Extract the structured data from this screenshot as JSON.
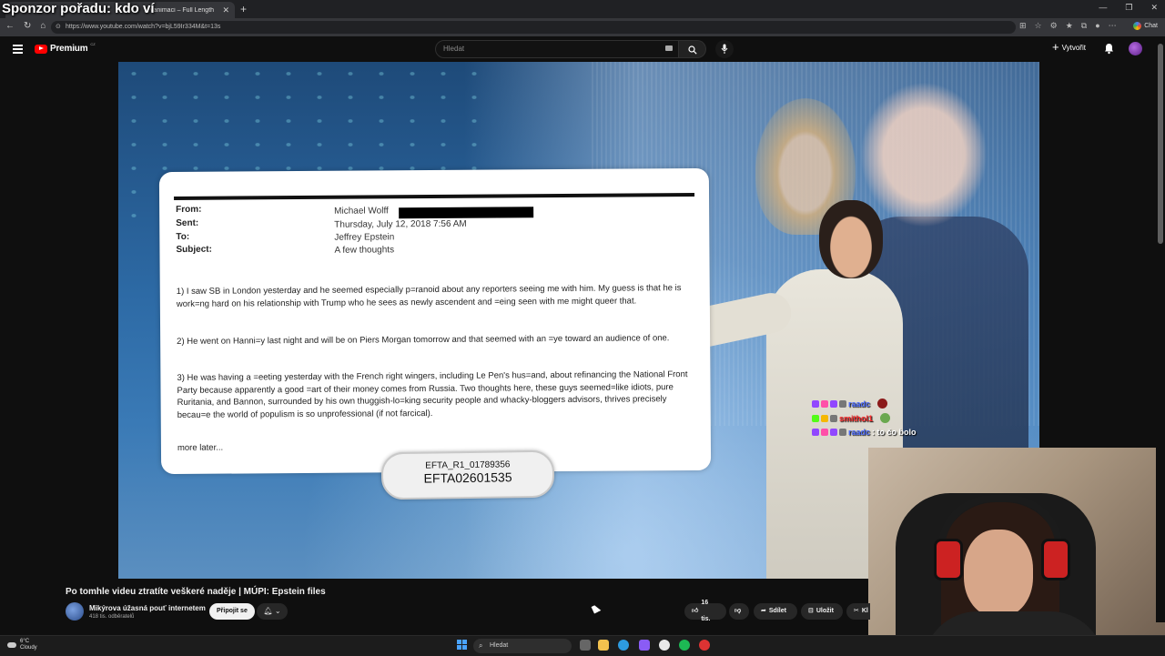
{
  "overlay": {
    "sponsor_text": "Sponzor pořadu: kdo ví"
  },
  "browser": {
    "tab_title": "…vanimaci – Full Length",
    "tab_close": "✕",
    "new_tab": "+",
    "url": "https://www.youtube.com/watch?v=bjL59Ir334M&t=13s",
    "chat_label": "Chat",
    "window_buttons": [
      "—",
      "❐",
      "✕"
    ]
  },
  "youtube": {
    "logo_text": "Premium",
    "country_code": "CZ",
    "search_placeholder": "Hledat",
    "create_label": "Vytvořit"
  },
  "email": {
    "from_label": "From:",
    "from_value": "Michael Wolff",
    "sent_label": "Sent:",
    "sent_value": "Thursday, July 12, 2018 7:56 AM",
    "to_label": "To:",
    "to_value": "Jeffrey Epstein",
    "subject_label": "Subject:",
    "subject_value": "A few thoughts",
    "para1": "1) I saw SB in London yesterday and he seemed especially p=ranoid about any reporters seeing me with him. My guess is that he is work=ng hard on his relationship with Trump who he sees as newly ascendent and =eing seen with me might queer that.",
    "para2": "2) He went on Hanni=y last night and will be on Piers Morgan tomorrow and that seemed with an =ye toward an audience of one.",
    "para3": "3) He was having a =eeting yesterday with the French right wingers, including Le Pen's hus=and, about refinancing the National Front Party because apparently a good =art of their money comes from Russia. Two thoughts here, these guys seemed=like idiots, pure Ruritania, and Bannon, surrounded by his own thuggish-lo=king security people and whacky-bloggers advisors, thrives precisely becau=e the world of populism is so unprofessional (if not farcical).",
    "closing": "more later...",
    "tag_line1": "EFTA_R1_01789356",
    "tag_line2": "EFTA02601535"
  },
  "chat": [
    {
      "user": "raadc",
      "user_color": "#4b6bff",
      "message": "",
      "emote_color": "#8b1a1a"
    },
    {
      "user": "smithol1",
      "user_color": "#ff2a2a",
      "message": "",
      "emote_color": "#6aa84f"
    },
    {
      "user": "raadc",
      "user_color": "#4b6bff",
      "message": ": to čo bolo",
      "emote_color": ""
    }
  ],
  "video_info": {
    "title": "Po tomhle videu ztratíte veškeré naděje | MÚPI: Epstein files",
    "channel": "Mikýrova úžasná pouť internetem",
    "subscribers": "418 tis. odběratelů",
    "join_label": "Připojit se",
    "like_count": "16 tis.",
    "share_label": "Sdílet",
    "save_label": "Uložit",
    "clip_label": "Kl"
  },
  "taskbar": {
    "temperature": "6°C",
    "weather": "Cloudy",
    "search_label": "Hledat"
  },
  "colors": {
    "brand_red": "#ff0000",
    "accent_blue": "#3ea6ff"
  }
}
